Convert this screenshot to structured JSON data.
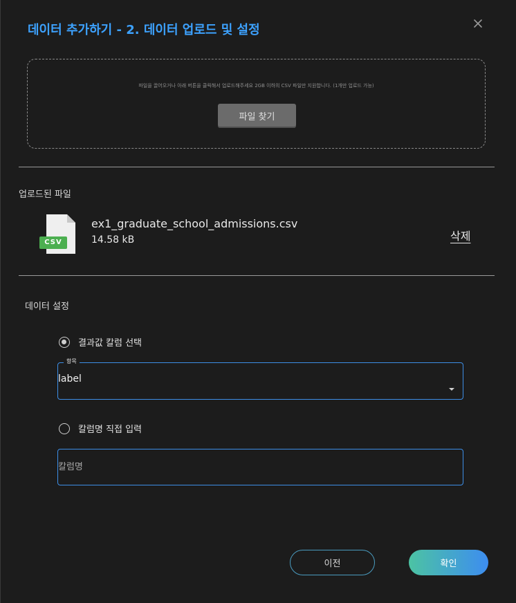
{
  "dialog": {
    "title": "데이터 추가하기 - 2. 데이터 업로드 및 설정",
    "close_icon": "close-icon"
  },
  "dropzone": {
    "hint": "파일을 끌어오거나 아래 버튼을 클릭해서 업로드해주세요 2GB 이하의 CSV 파일만 지원합니다. (1개만 업로드 가능)",
    "find_button_label": "파일 찾기"
  },
  "uploaded": {
    "section_label": "업로드된 파일",
    "file_icon": "csv-file-icon",
    "file_badge": "CSV",
    "file_name": "ex1_graduate_school_admissions.csv",
    "file_size": "14.58 kB",
    "delete_label": "삭제"
  },
  "settings": {
    "section_label": "데이터 설정",
    "option_select": {
      "label": "결과값 칼럼 선택",
      "checked": true,
      "field_legend": "항목",
      "field_value": "label"
    },
    "option_input": {
      "label": "칼럼명 직접 입력",
      "checked": false,
      "field_placeholder": "칼럼명"
    }
  },
  "footer": {
    "prev_label": "이전",
    "ok_label": "확인"
  },
  "colors": {
    "title": "#3da2ff",
    "accent_border": "#3d8fe8",
    "ok_gradient_start": "#4cc3a3",
    "ok_gradient_end": "#3d8df0",
    "csv_badge": "#4caf50"
  }
}
